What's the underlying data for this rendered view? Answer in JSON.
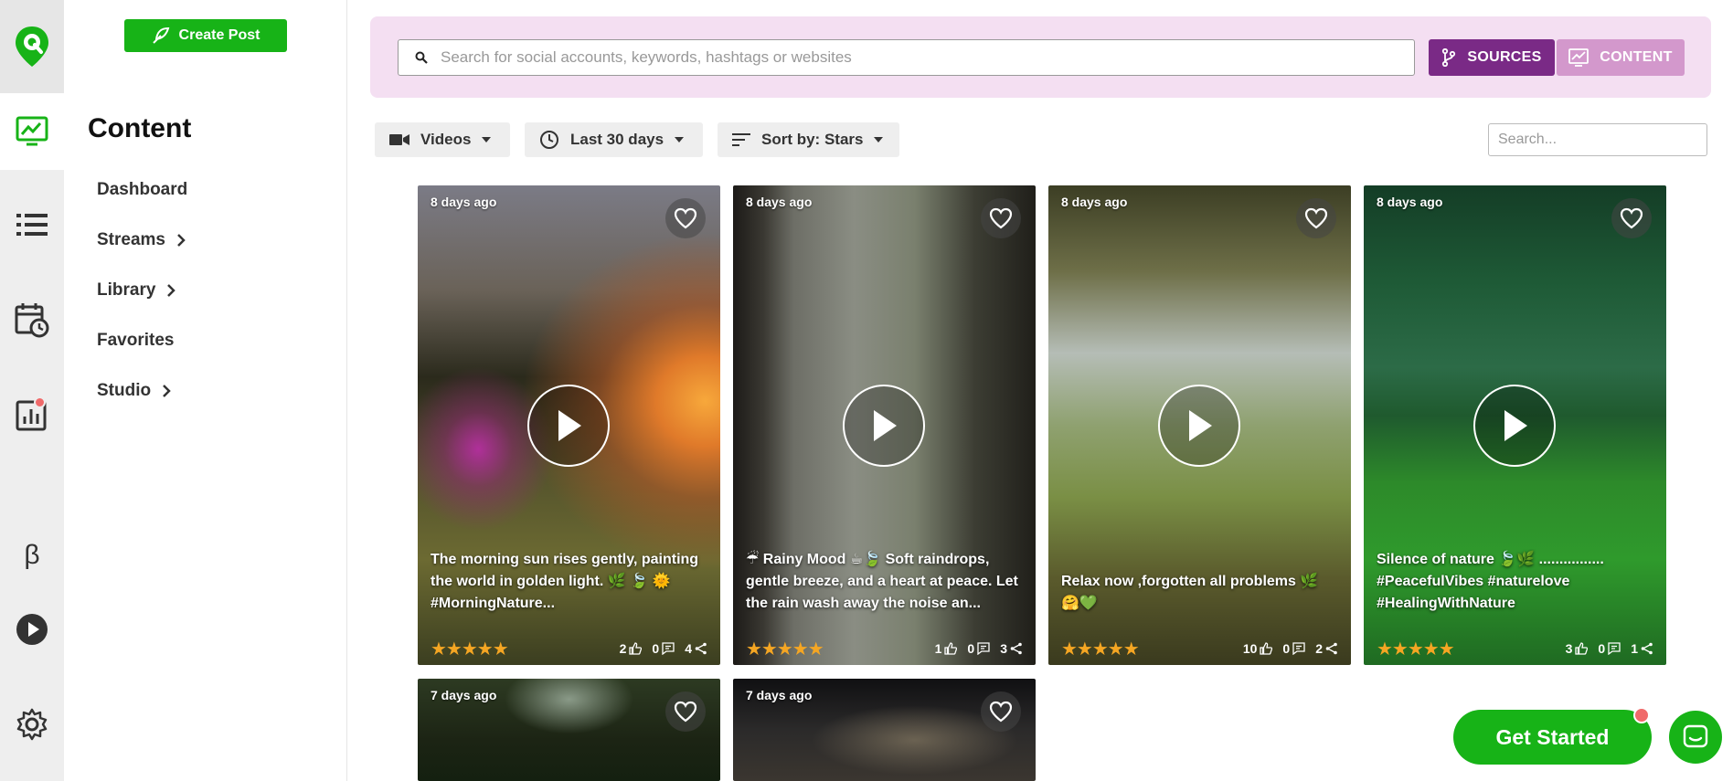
{
  "rail": {
    "items": [
      "logo-icon",
      "content-icon",
      "streams-list-icon",
      "calendar-clock-icon",
      "analytics-icon",
      "beta-icon",
      "play-circle-icon",
      "gear-icon"
    ],
    "beta_label": "β",
    "accent": "#17b317"
  },
  "nav": {
    "create_label": "Create Post",
    "title": "Content",
    "items": [
      {
        "label": "Dashboard",
        "has_chevron": false
      },
      {
        "label": "Streams",
        "has_chevron": true
      },
      {
        "label": "Library",
        "has_chevron": true
      },
      {
        "label": "Favorites",
        "has_chevron": false
      },
      {
        "label": "Studio",
        "has_chevron": true
      }
    ]
  },
  "search": {
    "placeholder": "Search for social accounts, keywords, hashtags or websites",
    "sources_label": "SOURCES",
    "content_label": "CONTENT"
  },
  "filters": {
    "type_label": "Videos",
    "range_label": "Last 30 days",
    "sort_label": "Sort by: Stars",
    "search_placeholder": "Search..."
  },
  "cards": [
    {
      "age": "8 days ago",
      "caption": "The morning sun rises gently, painting the world in golden light. 🌿 🍃 🌞 #MorningNature...",
      "stars": "★★★★★",
      "likes": "2",
      "comments": "0",
      "shares": "4"
    },
    {
      "age": "8 days ago",
      "caption": "☔ Rainy Mood ☕🍃 Soft raindrops, gentle breeze, and a heart at peace. Let the rain wash away the noise an...",
      "stars": "★★★★★",
      "likes": "1",
      "comments": "0",
      "shares": "3"
    },
    {
      "age": "8 days ago",
      "caption": "Relax now ,forgotten all problems 🌿 🤗💚",
      "stars": "★★★★★",
      "likes": "10",
      "comments": "0",
      "shares": "2"
    },
    {
      "age": "8 days ago",
      "caption": "Silence of nature 🍃🌿 ................ #PeacefulVibes #naturelove #HealingWithNature",
      "stars": "★★★★★",
      "likes": "3",
      "comments": "0",
      "shares": "1"
    },
    {
      "age": "7 days ago"
    },
    {
      "age": "7 days ago"
    }
  ],
  "floating": {
    "get_started_label": "Get Started"
  }
}
